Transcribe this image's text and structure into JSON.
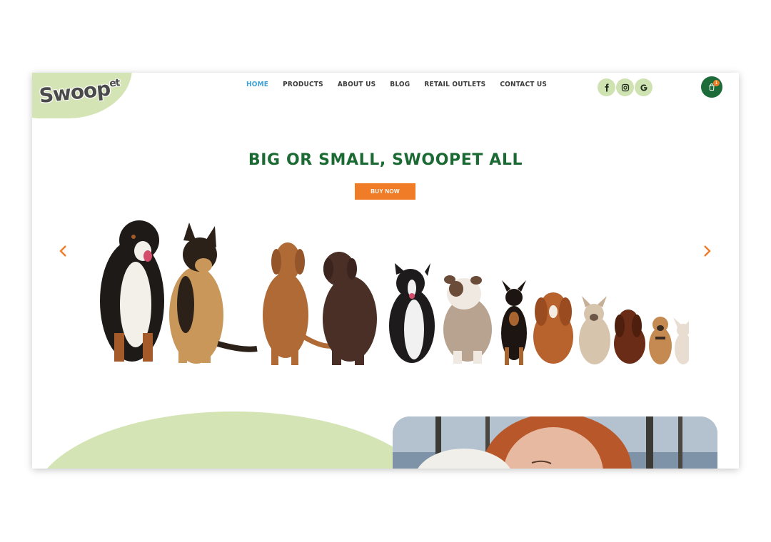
{
  "brand": {
    "logo_text": "Swoop",
    "logo_suffix": "et"
  },
  "nav": [
    {
      "label": "HOME",
      "active": true
    },
    {
      "label": "PRODUCTS",
      "active": false
    },
    {
      "label": "ABOUT US",
      "active": false
    },
    {
      "label": "BLOG",
      "active": false
    },
    {
      "label": "RETAIL OUTLETS",
      "active": false
    },
    {
      "label": "CONTACT US",
      "active": false
    }
  ],
  "social": [
    "facebook-icon",
    "instagram-icon",
    "google-icon"
  ],
  "cart": {
    "count": "1"
  },
  "hero": {
    "title": "BIG OR SMALL, SWOOPET ALL",
    "button_label": "BUY NOW"
  },
  "colors": {
    "accent_green": "#1b6a33",
    "light_green": "#d4e4b4",
    "orange": "#f07c28",
    "active_nav": "#3fa0d4"
  }
}
